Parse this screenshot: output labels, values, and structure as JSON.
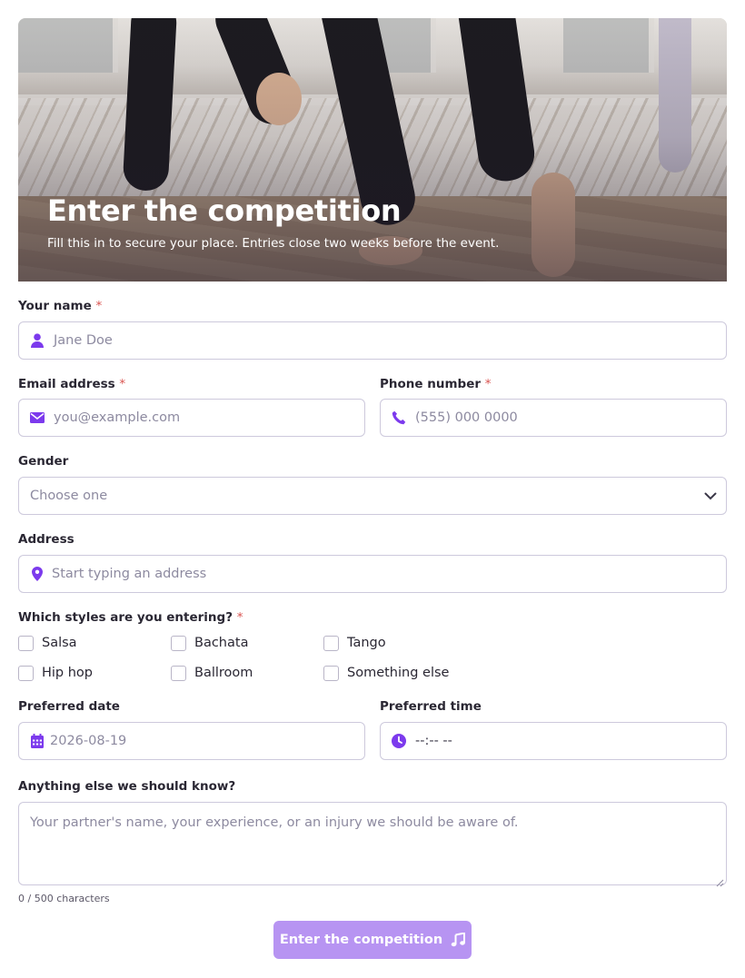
{
  "hero": {
    "title": "Enter the competition",
    "subtitle": "Fill this in to secure your place. Entries close two weeks before the event."
  },
  "fields": {
    "name": {
      "label": "Your name",
      "required_mark": "*",
      "placeholder": "Jane Doe",
      "icon": "user-icon"
    },
    "email": {
      "label": "Email address",
      "required_mark": "*",
      "placeholder": "you@example.com",
      "icon": "envelope-icon"
    },
    "phone": {
      "label": "Phone number",
      "required_mark": "*",
      "placeholder": "(555) 000 0000",
      "icon": "phone-icon"
    },
    "gender": {
      "label": "Gender",
      "selected": "Choose one",
      "icon": "chevron-down-icon"
    },
    "address": {
      "label": "Address",
      "placeholder": "Start typing an address",
      "icon": "map-pin-icon"
    },
    "date": {
      "label": "Preferred date",
      "value": "2026-08-19",
      "icon": "calendar-icon"
    },
    "time": {
      "label": "Preferred time",
      "value": "--:-- --",
      "icon": "clock-icon"
    },
    "notes": {
      "label": "Anything else we should know?",
      "placeholder": "Your partner's name, your experience, or an injury we should be aware of.",
      "counter": "0 / 500 characters"
    }
  },
  "styles": {
    "label": "Which styles are you entering?",
    "required_mark": "*",
    "options": [
      "Salsa",
      "Bachata",
      "Tango",
      "Hip hop",
      "Ballroom",
      "Something else"
    ]
  },
  "submit": {
    "label": "Enter the competition",
    "icon": "music-note-icon"
  },
  "colors": {
    "accent": "#7c3aed",
    "button": "#b794f2",
    "required": "#d9534f",
    "border": "#cdc9dc"
  }
}
